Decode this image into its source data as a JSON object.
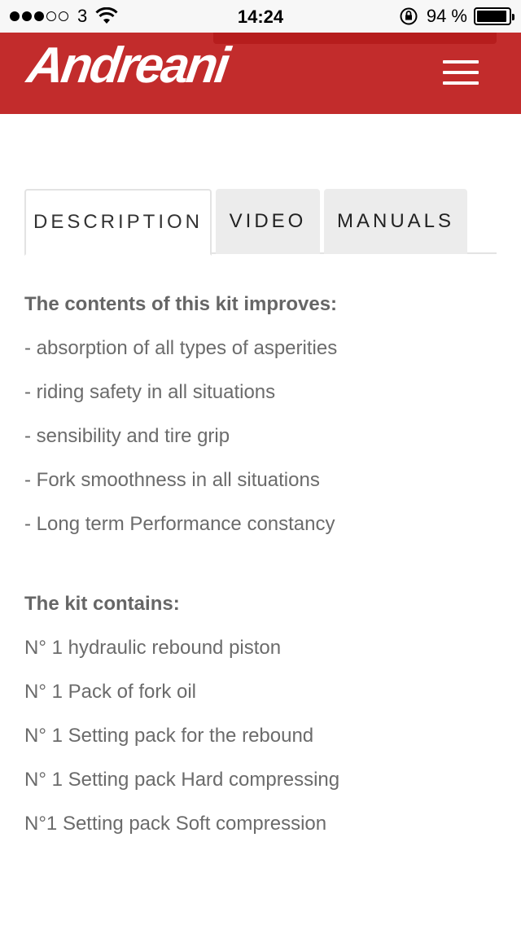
{
  "status_bar": {
    "carrier": "3",
    "time": "14:24",
    "battery_text": "94 %",
    "battery_level": 0.94,
    "signal_dots": [
      true,
      true,
      true,
      false,
      false
    ]
  },
  "header": {
    "logo_text": "Andreani",
    "menu_icon": "hamburger-icon",
    "background_color": "#c22c2c"
  },
  "tabs": [
    {
      "label": "DESCRIPTION",
      "active": true
    },
    {
      "label": "VIDEO",
      "active": false
    },
    {
      "label": "MANUALS",
      "active": false
    }
  ],
  "description": {
    "improves_heading": "The contents of this kit improves:",
    "improves_items": [
      "- absorption of all types of asperities",
      "- riding safety in all situations",
      "- sensibility and tire grip",
      "- Fork smoothness in all situations",
      "- Long term Performance constancy"
    ],
    "contains_heading": "The kit contains:",
    "contains_items": [
      "N° 1 hydraulic rebound piston",
      "N° 1 Pack of fork oil",
      "N° 1 Setting pack for the rebound",
      "N° 1 Setting pack Hard compressing",
      "N°1 Setting pack Soft compression"
    ]
  }
}
